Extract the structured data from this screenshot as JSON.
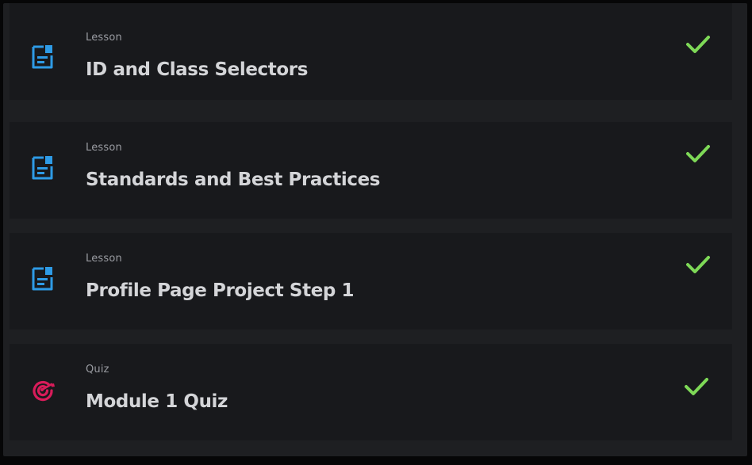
{
  "colors": {
    "lesson_icon": "#2e9be6",
    "quiz_icon": "#d81c5a",
    "check": "#7ed957",
    "item_bg": "#18191c",
    "gap_bg": "#1e1f22"
  },
  "items": [
    {
      "kind": "Lesson",
      "title": "ID and Class Selectors",
      "icon": "document-icon",
      "completed": true
    },
    {
      "kind": "Lesson",
      "title": "Standards and Best Practices",
      "icon": "document-icon",
      "completed": true
    },
    {
      "kind": "Lesson",
      "title": "Profile Page Project Step 1",
      "icon": "document-icon",
      "completed": true
    },
    {
      "kind": "Quiz",
      "title": "Module 1 Quiz",
      "icon": "target-icon",
      "completed": true
    }
  ]
}
